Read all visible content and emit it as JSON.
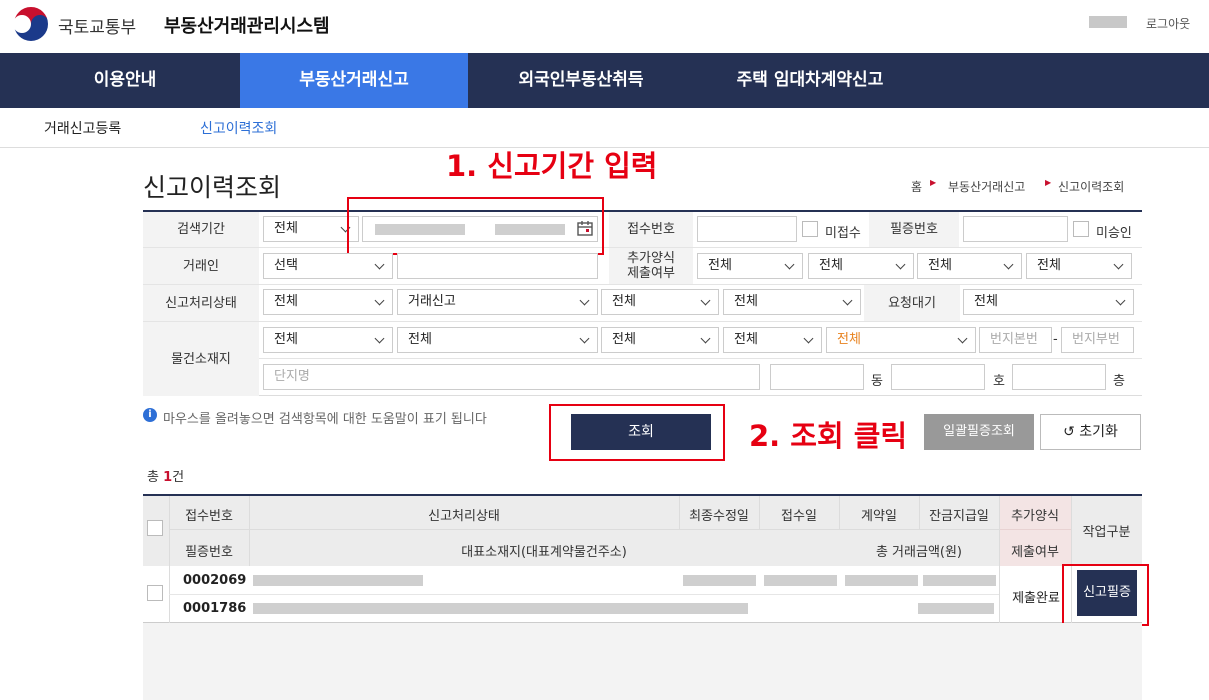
{
  "header": {
    "ministry": "국토교통부",
    "system_title": "부동산거래관리시스템",
    "logout": "로그아웃"
  },
  "gnb": {
    "items": [
      "이용안내",
      "부동산거래신고",
      "외국인부동산취득",
      "주택 임대차계약신고"
    ],
    "active_index": 1
  },
  "subnav": {
    "items": [
      "거래신고등록",
      "신고이력조회"
    ],
    "active_index": 1
  },
  "page": {
    "title": "신고이력조회",
    "breadcrumb": [
      "홈",
      "부동산거래신고",
      "신고이력조회"
    ]
  },
  "annotations": {
    "step1": "1. 신고기간 입력",
    "step2": "2. 조회 클릭"
  },
  "form": {
    "labels": {
      "period": "검색기간",
      "party": "거래인",
      "status": "신고처리상태",
      "location": "물건소재지",
      "receipt_no": "접수번호",
      "not_received": "미접수",
      "cert_no": "필증번호",
      "not_approved": "미승인",
      "extra_form_1": "추가양식",
      "extra_form_2": "제출여부",
      "request_wait": "요청대기",
      "dong": "동",
      "ho": "호",
      "floor": "층"
    },
    "period_type": "전체",
    "party_select": "선택",
    "extra_selects": [
      "전체",
      "전체",
      "전체",
      "전체"
    ],
    "status_selects": [
      "전체",
      "거래신고",
      "전체",
      "전체"
    ],
    "request_wait_select": "전체",
    "location_selects": [
      "전체",
      "전체",
      "전체",
      "전체",
      "전체"
    ],
    "location_highlight_color": "#e8821e",
    "placeholders": {
      "bonbun": "번지본번",
      "bubun": "번지부번",
      "complex": "단지명"
    },
    "dash": "-"
  },
  "help_text": "마우스를 올려놓으면 검색항목에 대한 도움말이 표기 됩니다",
  "buttons": {
    "search": "조회",
    "bulk_cert": "일괄필증조회",
    "reset": "초기화"
  },
  "total": {
    "prefix": "총 ",
    "count": "1",
    "suffix": "건"
  },
  "table": {
    "headers_row1": [
      "접수번호",
      "신고처리상태",
      "최종수정일",
      "접수일",
      "계약일",
      "잔금지급일",
      "추가양식"
    ],
    "headers_row2": [
      "필증번호",
      "대표소재지(대표계약물건주소)",
      "총 거래금액(원)",
      "제출여부"
    ],
    "work_header": "작업구분",
    "rows": [
      {
        "receipt_no": "0002069",
        "cert_no": "0001786",
        "extra_form": "제출완료",
        "action": "신고필증"
      }
    ]
  },
  "colors": {
    "navy": "#253154",
    "active_blue": "#3a78e6",
    "annotation_red": "#e60012"
  }
}
